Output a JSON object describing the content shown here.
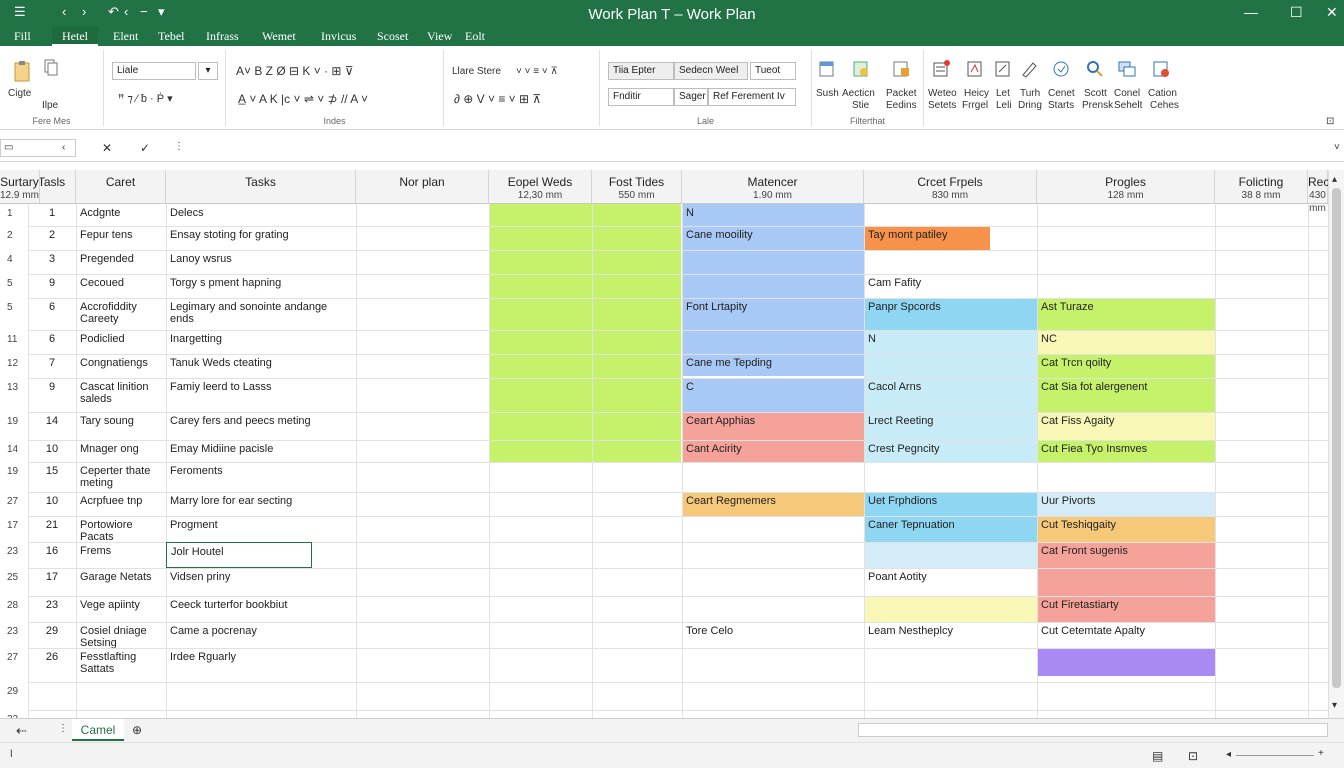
{
  "title": "Work Plan T – Work Plan",
  "tabs": [
    "Fill",
    "Hetel",
    "Elent",
    "Tebel",
    "Infrass",
    "Wemet",
    "Invicus",
    "Scoset",
    "View",
    "Eolt"
  ],
  "ribbon": {
    "clipboard": {
      "paste": "Cigte",
      "cut": "Ilpe",
      "label": "Fere Mes"
    },
    "font": {
      "font_name": "Liale",
      "label": "Indes"
    },
    "align": {
      "font2": "Llare Stere",
      "label": ""
    },
    "styles": {
      "b1": "Tiia Epter",
      "b2": "Sedecn Weel",
      "b3": "Tueot",
      "b4": "Fnditir",
      "b5": "Sager",
      "b6": "Ref Ferement Iv",
      "label": "Lale"
    },
    "cells": {
      "i1": "Sush",
      "i2": "Aecticn",
      "i2b": "Stie",
      "i3": "Packet",
      "i3b": "Eedins",
      "label": "Filterthat"
    },
    "editing": {
      "i1": "Weteo",
      "i1b": "Setets",
      "i2": "Heicy",
      "i2b": "Frrgel",
      "i3": "Let",
      "i3b": "Leli",
      "i4": "Turh",
      "i4b": "Dring",
      "i5": "Cenet",
      "i5b": "Starts",
      "i6": "Scott",
      "i6b": "Prensk",
      "i7": "Conel",
      "i7b": "Sehelt",
      "i8": "Cation",
      "i8b": "Cehes"
    }
  },
  "formula_bar": {
    "name_box": "",
    "content": ""
  },
  "columns": [
    {
      "h": "Tasls",
      "s": ""
    },
    {
      "h": "Caret",
      "s": ""
    },
    {
      "h": "Tasks",
      "s": ""
    },
    {
      "h": "Nor plan",
      "s": ""
    },
    {
      "h": "Eopel Weds",
      "s": "12,30 mm"
    },
    {
      "h": "Fost Tides",
      "s": "550 mm"
    },
    {
      "h": "Matencer",
      "s": "1.90 mm"
    },
    {
      "h": "Crcet Frpels",
      "s": "830 mm"
    },
    {
      "h": "Progles",
      "s": "128 mm"
    },
    {
      "h": "Folicting",
      "s": "38 8 mm"
    },
    {
      "h": "Recroidny",
      "s": "430 mm"
    },
    {
      "h": "Surtary",
      "s": "12.9 mm"
    }
  ],
  "rows": [
    {
      "rn": "1",
      "n": "1",
      "name": "Acdgnte",
      "task": "Delecs"
    },
    {
      "rn": "2",
      "n": "2",
      "name": "Fepur tens",
      "task": "Ensay stoting for grating"
    },
    {
      "rn": "4",
      "n": "3",
      "name": "Pregended",
      "task": "Lanoy wsrus"
    },
    {
      "rn": "5",
      "n": "9",
      "name": "Cecoued",
      "task": "Torgy s pment hapning"
    },
    {
      "rn": "5",
      "n": "6",
      "name": "Accrofiddity Careety",
      "task": "Legimary and sonointe andange ends"
    },
    {
      "rn": "11",
      "n": "6",
      "name": "Podiclied",
      "task": "Inargetting"
    },
    {
      "rn": "12",
      "n": "7",
      "name": "Congnatiengs",
      "task": "Tanuk Weds cteating"
    },
    {
      "rn": "13",
      "n": "9",
      "name": "Cascat linition saleds",
      "task": "Famiy leerd to Lasss"
    },
    {
      "rn": "19",
      "n": "14",
      "name": "Tary soung",
      "task": "Carey fers and peecs meting"
    },
    {
      "rn": "14",
      "n": "10",
      "name": "Mnager ong",
      "task": "Emay Midiine pacisle"
    },
    {
      "rn": "19",
      "n": "15",
      "name": "Ceperter thate meting",
      "task": "Feroments"
    },
    {
      "rn": "27",
      "n": "10",
      "name": "Acrpfuee tnp",
      "task": "Marry lore for ear secting"
    },
    {
      "rn": "17",
      "n": "21",
      "name": "Portowiore Pacats",
      "task": "Progment"
    },
    {
      "rn": "23",
      "n": "16",
      "name": "Frems",
      "task": "Jolr Houtel"
    },
    {
      "rn": "25",
      "n": "17",
      "name": "Garage Netats",
      "task": "Vidsen priny"
    },
    {
      "rn": "28",
      "n": "23",
      "name": "Vege apiinty",
      "task": "Ceeck turterfor bookbiut"
    },
    {
      "rn": "23",
      "n": "29",
      "name": "Cosiel dniage Setsing",
      "task": "Came a pocrenay"
    },
    {
      "rn": "27",
      "n": "26",
      "name": "Fesstlafting Sattats",
      "task": "Irdee Rguarly"
    },
    {
      "rn": "29",
      "n": "",
      "name": "",
      "task": ""
    },
    {
      "rn": "23",
      "n": "",
      "name": "",
      "task": ""
    }
  ],
  "cells": {
    "matencer": [
      "N",
      "Cane mooility",
      "",
      "",
      "Font Lrtapity",
      "",
      "Cane me Tepding",
      "C",
      "Ceart Apphias",
      "Cant Acirity",
      "",
      "Ceart Regmemers",
      "",
      "",
      "",
      "",
      "Tore Celo",
      ""
    ],
    "progles": [
      "",
      "Tay mont patiley",
      "",
      "Cam Fafity",
      "Panpr Spcords",
      "N",
      "",
      "Cacol Arns",
      "Lrect Reeting",
      "Crest Pegncity",
      "",
      "Uet Frphdions",
      "Caner Tepnuation",
      "",
      "Poant Aotity",
      "",
      "Leam Nestheplcy",
      ""
    ],
    "recroidny": [
      "",
      "",
      "",
      "",
      "Ast Turaze",
      "NC",
      "Cat Trcn qoilty",
      "Cat Sia fot alergenent",
      "Cat Fiss Agaity",
      "Cut Fiea Tyo Insmves",
      "",
      "Uur Pivorts",
      "Cut Teshiqgaity",
      "Cat Front sugenis",
      "",
      "Cut Firetastiarty",
      "Cut Cetemtate Apalty",
      ""
    ]
  },
  "sheet_tab": "Camel",
  "colors": {
    "green": "#c5f26a",
    "blue": "#a8c8f5",
    "lightblue": "#d3ecf8",
    "cyan": "#8fd6f2",
    "orange": "#f6c87a",
    "deeporange": "#f7924a",
    "red": "#f5a39a",
    "yellow": "#f8f7b5",
    "purple": "#a98af2",
    "teal": "#c8ecf7"
  }
}
